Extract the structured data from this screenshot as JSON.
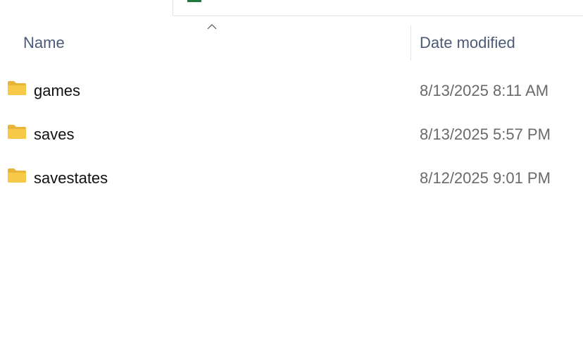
{
  "columns": {
    "name_label": "Name",
    "date_label": "Date modified",
    "sort_column": "Name",
    "sort_direction": "ascending"
  },
  "items": [
    {
      "name": "games",
      "date_modified": "8/13/2025 8:11 AM",
      "type": "folder",
      "icon": "folder-icon"
    },
    {
      "name": "saves",
      "date_modified": "8/13/2025 5:57 PM",
      "type": "folder",
      "icon": "folder-icon"
    },
    {
      "name": "savestates",
      "date_modified": "8/12/2025 9:01 PM",
      "type": "folder",
      "icon": "folder-icon"
    }
  ],
  "colors": {
    "header_text": "#4a5a78",
    "name_text": "#111111",
    "date_text": "#6a6a6a",
    "folder_fill": "#f7c948",
    "accent_green": "#1e7a3a"
  }
}
